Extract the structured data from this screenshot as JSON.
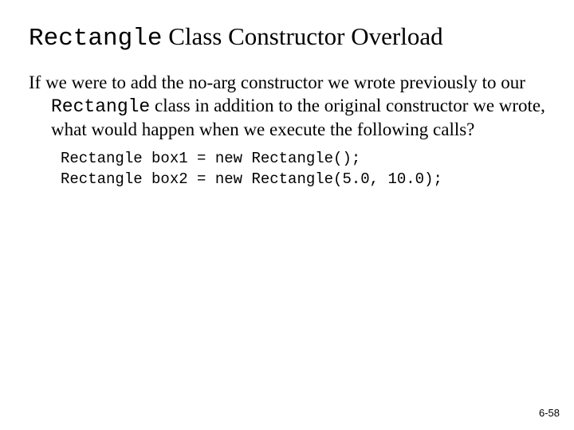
{
  "title": {
    "code": "Rectangle",
    "rest": " Class Constructor Overload"
  },
  "paragraph": {
    "pre": "If we were to add the no-arg constructor we wrote previously to our ",
    "code": "Rectangle",
    "post": " class in addition to the original constructor we wrote, what would happen when we execute the following calls?"
  },
  "code": {
    "line1": "Rectangle box1 = new Rectangle();",
    "line2": "Rectangle box2 = new Rectangle(5.0, 10.0);"
  },
  "page_number": "6-58"
}
